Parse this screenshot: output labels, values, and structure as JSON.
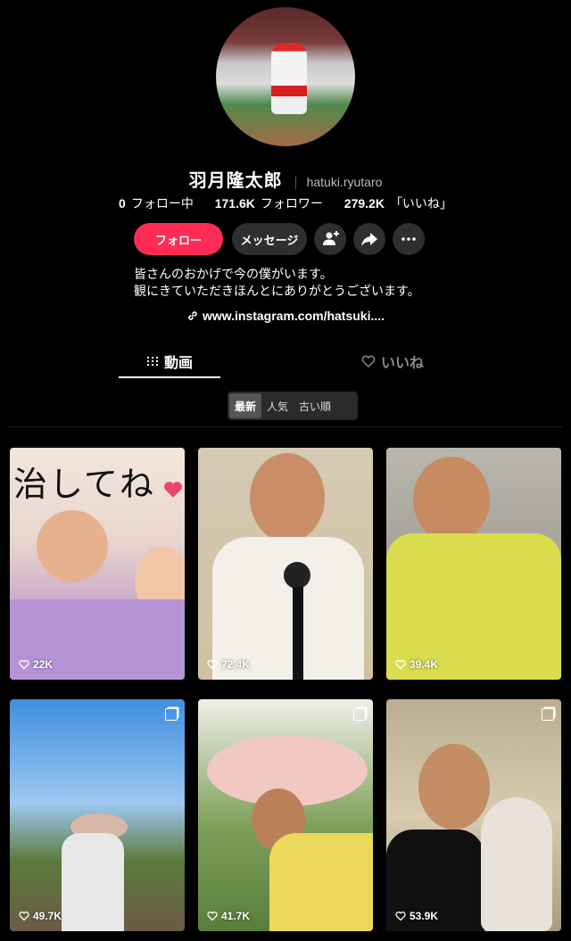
{
  "profile": {
    "name": "羽月隆太郎",
    "handle": "hatuki.ryutaro",
    "stats": {
      "following_count": "0",
      "following_label": "フォロー中",
      "followers_count": "171.6K",
      "followers_label": "フォロワー",
      "likes_count": "279.2K",
      "likes_label": "「いいね」"
    },
    "buttons": {
      "follow": "フォロー",
      "message": "メッセージ"
    },
    "bio_line1": "皆さんのおかげで今の僕がいます。",
    "bio_line2": "観にきていただきほんとにありがとうございます。",
    "link": "www.instagram.com/hatsuki...."
  },
  "tabs": {
    "videos": "動画",
    "likes": "いいね"
  },
  "sort": {
    "latest": "最新",
    "popular": "人気",
    "oldest": "古い順"
  },
  "videos": [
    {
      "views": "22K",
      "caption": "治してね"
    },
    {
      "views": "72.4K"
    },
    {
      "views": "39.4K"
    },
    {
      "views": "49.7K"
    },
    {
      "views": "41.7K"
    },
    {
      "views": "53.9K"
    }
  ]
}
